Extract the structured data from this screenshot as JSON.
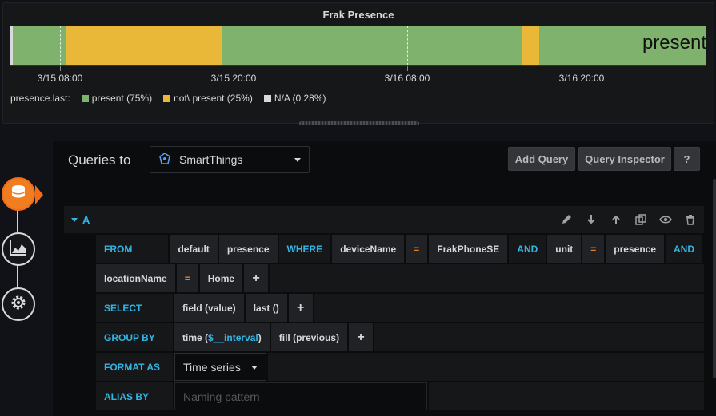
{
  "panel": {
    "title": "Frak Presence",
    "value_label": "present",
    "x_ticks": [
      "3/15 08:00",
      "3/15 20:00",
      "3/16 08:00",
      "3/16 20:00"
    ],
    "legend": {
      "series_label": "presence.last:",
      "items": [
        {
          "label": "present (75%)",
          "color": "#7eb26d"
        },
        {
          "label": "not\\ present (25%)",
          "color": "#eab839"
        },
        {
          "label": "N/A (0.28%)",
          "color": "#d8d9da"
        }
      ]
    },
    "colors": {
      "present": "#7eb26d",
      "not_present": "#eab839",
      "na": "#d8d9da"
    }
  },
  "sidebar": {
    "items": [
      {
        "icon": "database-icon",
        "active": true
      },
      {
        "icon": "chart-area-icon",
        "active": false
      },
      {
        "icon": "gear-icon",
        "active": false
      }
    ]
  },
  "editor": {
    "queries_to_label": "Queries to",
    "datasource": {
      "name": "SmartThings",
      "icon": "smartthings-icon"
    },
    "buttons": {
      "add_query": "Add Query",
      "query_inspector": "Query Inspector",
      "help": "?"
    },
    "query": {
      "ref_id": "A",
      "from": {
        "keyword": "FROM",
        "policy": "default",
        "measurement": "presence",
        "where_keyword": "WHERE",
        "conditions": [
          {
            "key": "deviceName",
            "op": "=",
            "value": "FrakPhoneSE",
            "joiner": "AND"
          },
          {
            "key": "unit",
            "op": "=",
            "value": "presence",
            "joiner": "AND"
          },
          {
            "key": "locationName",
            "op": "=",
            "value": "Home"
          }
        ]
      },
      "select": {
        "keyword": "SELECT",
        "parts": [
          "field (value)",
          "last ()"
        ]
      },
      "group_by": {
        "keyword": "GROUP BY",
        "time_prefix": "time (",
        "time_var": "$__interval",
        "time_suffix": ")",
        "fill": "fill (previous)"
      },
      "format_as": {
        "keyword": "FORMAT AS",
        "value": "Time series"
      },
      "alias_by": {
        "keyword": "ALIAS BY",
        "placeholder": "Naming pattern"
      },
      "plus": "+"
    }
  }
}
